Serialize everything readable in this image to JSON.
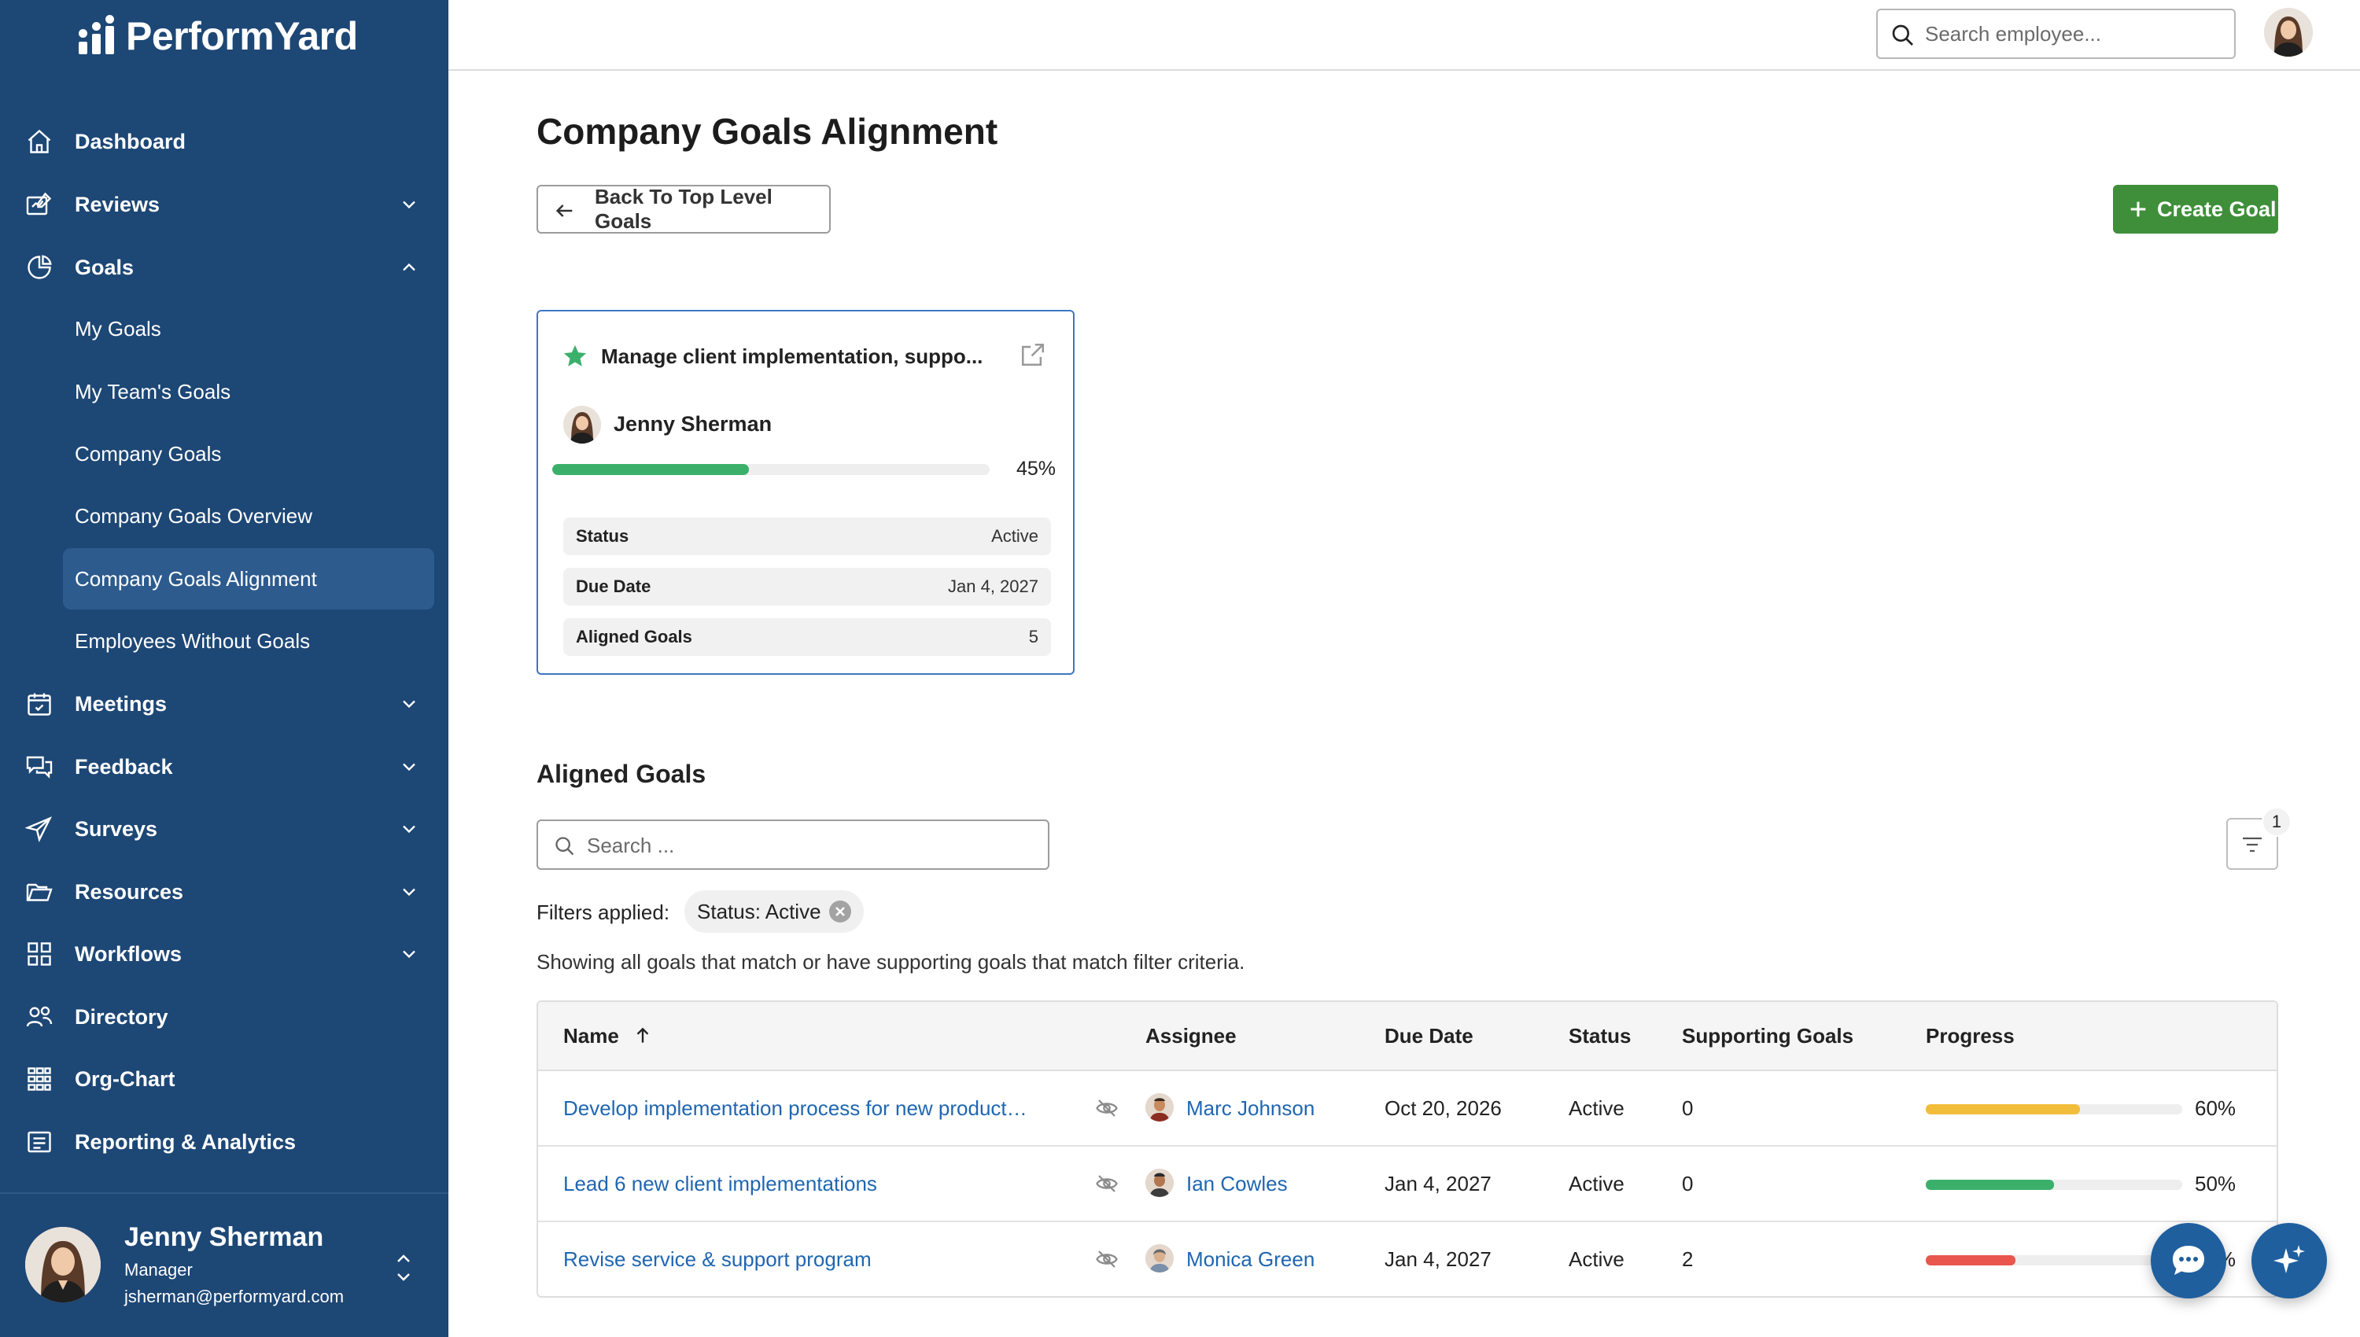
{
  "app": {
    "logo_text": "PerformYard"
  },
  "colors": {
    "sidebar": "#1d4775",
    "accent_green": "#3f8f3a",
    "link": "#1f66b1",
    "active_item": "#2d5b8e"
  },
  "sidebar": {
    "items": [
      {
        "label": "Dashboard",
        "icon": "home-icon"
      },
      {
        "label": "Reviews",
        "icon": "reviews-icon",
        "expandable": true
      },
      {
        "label": "Goals",
        "icon": "goals-icon",
        "expanded": true
      },
      {
        "label": "Meetings",
        "icon": "calendar-icon",
        "expandable": true
      },
      {
        "label": "Feedback",
        "icon": "chat-icon",
        "expandable": true
      },
      {
        "label": "Surveys",
        "icon": "send-icon",
        "expandable": true
      },
      {
        "label": "Resources",
        "icon": "folder-icon",
        "expandable": true
      },
      {
        "label": "Workflows",
        "icon": "workflow-icon",
        "expandable": true
      },
      {
        "label": "Directory",
        "icon": "people-icon"
      },
      {
        "label": "Org-Chart",
        "icon": "org-chart-icon"
      },
      {
        "label": "Reporting & Analytics",
        "icon": "report-icon"
      }
    ],
    "goals_subitems": [
      {
        "label": "My Goals"
      },
      {
        "label": "My Team's Goals"
      },
      {
        "label": "Company Goals"
      },
      {
        "label": "Company Goals Overview"
      },
      {
        "label": "Company Goals Alignment",
        "active": true
      },
      {
        "label": "Employees Without Goals"
      }
    ],
    "profile": {
      "name": "Jenny Sherman",
      "role": "Manager",
      "email": "jsherman@performyard.com"
    }
  },
  "topbar": {
    "search_placeholder": "Search employee..."
  },
  "main": {
    "title": "Company Goals Alignment",
    "back_button": "Back To Top Level Goals",
    "create_button": "Create Goal",
    "goal_card": {
      "title": "Manage client implementation, suppo...",
      "owner": "Jenny Sherman",
      "progress": 45,
      "progress_label": "45%",
      "fields": [
        {
          "label": "Status",
          "value": "Active"
        },
        {
          "label": "Due Date",
          "value": "Jan 4, 2027"
        },
        {
          "label": "Aligned Goals",
          "value": "5"
        }
      ]
    },
    "aligned": {
      "title": "Aligned Goals",
      "search_placeholder": "Search ...",
      "filter_count": "1",
      "filters_label": "Filters applied:",
      "filter_chip": "Status: Active",
      "showing_text": "Showing all goals that match or have supporting goals that match filter criteria.",
      "columns": [
        "Name",
        "Assignee",
        "Due Date",
        "Status",
        "Supporting Goals",
        "Progress"
      ],
      "rows": [
        {
          "name": "Develop implementation process for new product…",
          "assignee": "Marc Johnson",
          "due": "Oct 20, 2026",
          "status": "Active",
          "supporting": "0",
          "progress": 60,
          "progress_label": "60%",
          "color": "#f2bd3a"
        },
        {
          "name": "Lead 6 new client implementations",
          "assignee": "Ian Cowles",
          "due": "Jan 4, 2027",
          "status": "Active",
          "supporting": "0",
          "progress": 50,
          "progress_label": "50%",
          "color": "#3bb06b"
        },
        {
          "name": "Revise service & support program",
          "assignee": "Monica Green",
          "due": "Jan 4, 2027",
          "status": "Active",
          "supporting": "2",
          "progress": 35,
          "progress_label": "35%",
          "color": "#e8564e"
        }
      ]
    }
  }
}
